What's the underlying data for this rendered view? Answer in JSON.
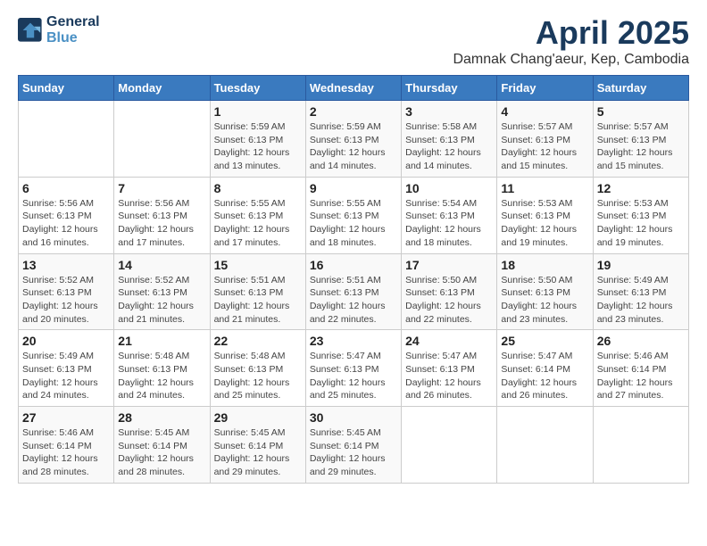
{
  "logo": {
    "line1": "General",
    "line2": "Blue"
  },
  "title": "April 2025",
  "subtitle": "Damnak Chang'aeur, Kep, Cambodia",
  "header": {
    "days": [
      "Sunday",
      "Monday",
      "Tuesday",
      "Wednesday",
      "Thursday",
      "Friday",
      "Saturday"
    ]
  },
  "weeks": [
    [
      {
        "day": "",
        "sunrise": "",
        "sunset": "",
        "daylight": ""
      },
      {
        "day": "",
        "sunrise": "",
        "sunset": "",
        "daylight": ""
      },
      {
        "day": "1",
        "sunrise": "Sunrise: 5:59 AM",
        "sunset": "Sunset: 6:13 PM",
        "daylight": "Daylight: 12 hours and 13 minutes."
      },
      {
        "day": "2",
        "sunrise": "Sunrise: 5:59 AM",
        "sunset": "Sunset: 6:13 PM",
        "daylight": "Daylight: 12 hours and 14 minutes."
      },
      {
        "day": "3",
        "sunrise": "Sunrise: 5:58 AM",
        "sunset": "Sunset: 6:13 PM",
        "daylight": "Daylight: 12 hours and 14 minutes."
      },
      {
        "day": "4",
        "sunrise": "Sunrise: 5:57 AM",
        "sunset": "Sunset: 6:13 PM",
        "daylight": "Daylight: 12 hours and 15 minutes."
      },
      {
        "day": "5",
        "sunrise": "Sunrise: 5:57 AM",
        "sunset": "Sunset: 6:13 PM",
        "daylight": "Daylight: 12 hours and 15 minutes."
      }
    ],
    [
      {
        "day": "6",
        "sunrise": "Sunrise: 5:56 AM",
        "sunset": "Sunset: 6:13 PM",
        "daylight": "Daylight: 12 hours and 16 minutes."
      },
      {
        "day": "7",
        "sunrise": "Sunrise: 5:56 AM",
        "sunset": "Sunset: 6:13 PM",
        "daylight": "Daylight: 12 hours and 17 minutes."
      },
      {
        "day": "8",
        "sunrise": "Sunrise: 5:55 AM",
        "sunset": "Sunset: 6:13 PM",
        "daylight": "Daylight: 12 hours and 17 minutes."
      },
      {
        "day": "9",
        "sunrise": "Sunrise: 5:55 AM",
        "sunset": "Sunset: 6:13 PM",
        "daylight": "Daylight: 12 hours and 18 minutes."
      },
      {
        "day": "10",
        "sunrise": "Sunrise: 5:54 AM",
        "sunset": "Sunset: 6:13 PM",
        "daylight": "Daylight: 12 hours and 18 minutes."
      },
      {
        "day": "11",
        "sunrise": "Sunrise: 5:53 AM",
        "sunset": "Sunset: 6:13 PM",
        "daylight": "Daylight: 12 hours and 19 minutes."
      },
      {
        "day": "12",
        "sunrise": "Sunrise: 5:53 AM",
        "sunset": "Sunset: 6:13 PM",
        "daylight": "Daylight: 12 hours and 19 minutes."
      }
    ],
    [
      {
        "day": "13",
        "sunrise": "Sunrise: 5:52 AM",
        "sunset": "Sunset: 6:13 PM",
        "daylight": "Daylight: 12 hours and 20 minutes."
      },
      {
        "day": "14",
        "sunrise": "Sunrise: 5:52 AM",
        "sunset": "Sunset: 6:13 PM",
        "daylight": "Daylight: 12 hours and 21 minutes."
      },
      {
        "day": "15",
        "sunrise": "Sunrise: 5:51 AM",
        "sunset": "Sunset: 6:13 PM",
        "daylight": "Daylight: 12 hours and 21 minutes."
      },
      {
        "day": "16",
        "sunrise": "Sunrise: 5:51 AM",
        "sunset": "Sunset: 6:13 PM",
        "daylight": "Daylight: 12 hours and 22 minutes."
      },
      {
        "day": "17",
        "sunrise": "Sunrise: 5:50 AM",
        "sunset": "Sunset: 6:13 PM",
        "daylight": "Daylight: 12 hours and 22 minutes."
      },
      {
        "day": "18",
        "sunrise": "Sunrise: 5:50 AM",
        "sunset": "Sunset: 6:13 PM",
        "daylight": "Daylight: 12 hours and 23 minutes."
      },
      {
        "day": "19",
        "sunrise": "Sunrise: 5:49 AM",
        "sunset": "Sunset: 6:13 PM",
        "daylight": "Daylight: 12 hours and 23 minutes."
      }
    ],
    [
      {
        "day": "20",
        "sunrise": "Sunrise: 5:49 AM",
        "sunset": "Sunset: 6:13 PM",
        "daylight": "Daylight: 12 hours and 24 minutes."
      },
      {
        "day": "21",
        "sunrise": "Sunrise: 5:48 AM",
        "sunset": "Sunset: 6:13 PM",
        "daylight": "Daylight: 12 hours and 24 minutes."
      },
      {
        "day": "22",
        "sunrise": "Sunrise: 5:48 AM",
        "sunset": "Sunset: 6:13 PM",
        "daylight": "Daylight: 12 hours and 25 minutes."
      },
      {
        "day": "23",
        "sunrise": "Sunrise: 5:47 AM",
        "sunset": "Sunset: 6:13 PM",
        "daylight": "Daylight: 12 hours and 25 minutes."
      },
      {
        "day": "24",
        "sunrise": "Sunrise: 5:47 AM",
        "sunset": "Sunset: 6:13 PM",
        "daylight": "Daylight: 12 hours and 26 minutes."
      },
      {
        "day": "25",
        "sunrise": "Sunrise: 5:47 AM",
        "sunset": "Sunset: 6:14 PM",
        "daylight": "Daylight: 12 hours and 26 minutes."
      },
      {
        "day": "26",
        "sunrise": "Sunrise: 5:46 AM",
        "sunset": "Sunset: 6:14 PM",
        "daylight": "Daylight: 12 hours and 27 minutes."
      }
    ],
    [
      {
        "day": "27",
        "sunrise": "Sunrise: 5:46 AM",
        "sunset": "Sunset: 6:14 PM",
        "daylight": "Daylight: 12 hours and 28 minutes."
      },
      {
        "day": "28",
        "sunrise": "Sunrise: 5:45 AM",
        "sunset": "Sunset: 6:14 PM",
        "daylight": "Daylight: 12 hours and 28 minutes."
      },
      {
        "day": "29",
        "sunrise": "Sunrise: 5:45 AM",
        "sunset": "Sunset: 6:14 PM",
        "daylight": "Daylight: 12 hours and 29 minutes."
      },
      {
        "day": "30",
        "sunrise": "Sunrise: 5:45 AM",
        "sunset": "Sunset: 6:14 PM",
        "daylight": "Daylight: 12 hours and 29 minutes."
      },
      {
        "day": "",
        "sunrise": "",
        "sunset": "",
        "daylight": ""
      },
      {
        "day": "",
        "sunrise": "",
        "sunset": "",
        "daylight": ""
      },
      {
        "day": "",
        "sunrise": "",
        "sunset": "",
        "daylight": ""
      }
    ]
  ]
}
